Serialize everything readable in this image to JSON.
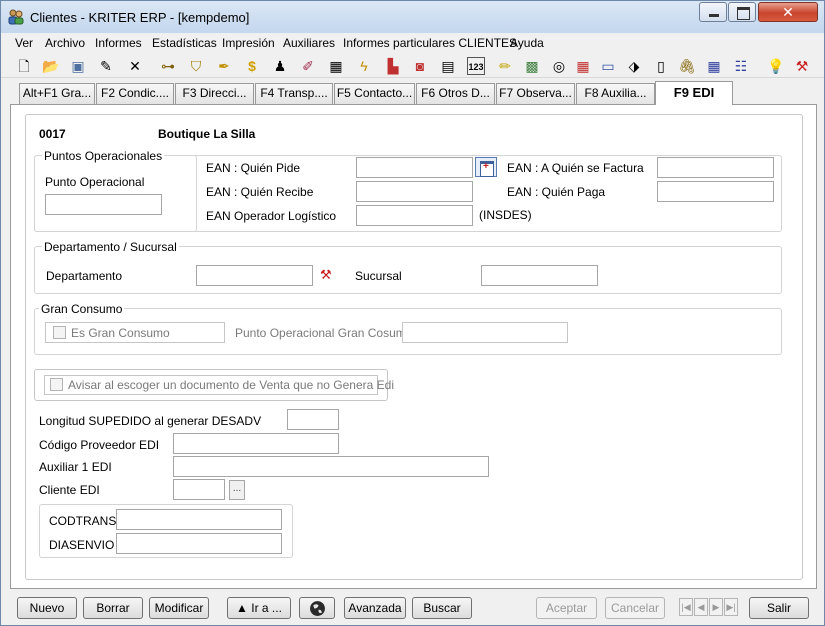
{
  "window": {
    "title": "Clientes - KRITER ERP - [kempdemo]",
    "close_glyph": "✕"
  },
  "menu": [
    "Ver",
    "Archivo",
    "Informes",
    "Estadísticas",
    "Impresión",
    "Auxiliares",
    "Informes particulares CLIENTES",
    "Ayuda"
  ],
  "toolbar_icons": [
    "new-document-icon",
    "open-folder-icon",
    "save-icon",
    "edit-icon",
    "delete-icon",
    "tree-icon",
    "filter-icon",
    "pen-icon",
    "money-icon",
    "stamp-icon",
    "paint-icon",
    "grid-icon",
    "lightning-icon",
    "bar-chart-icon",
    "camera-icon",
    "form-icon",
    "number-icon",
    "pencil-icon",
    "image-icon",
    "cd-icon",
    "calculator-icon",
    "calendar-icon",
    "box-icon",
    "notes-icon",
    "attachment-icon",
    "table-icon",
    "list-icon",
    "lightbulb-icon",
    "tools-icon"
  ],
  "tabs": [
    "Alt+F1 Gra...",
    "F2 Condic....",
    "F3 Direcci...",
    "F4 Transp....",
    "F5 Contacto...",
    "F6 Otros D...",
    "F7 Observa...",
    "F8 Auxilia...",
    "F9 EDI"
  ],
  "client": {
    "code": "0017",
    "name": "Boutique La Silla"
  },
  "puntos_operacionales": {
    "title": "Puntos Operacionales",
    "punto_label": "Punto Operacional",
    "punto_value": "",
    "ean_pide_label": "EAN : Quién Pide",
    "ean_pide_value": "",
    "ean_factura_label": "EAN : A Quién se Factura",
    "ean_factura_value": "",
    "ean_recibe_label": "EAN : Quién Recibe",
    "ean_recibe_value": "",
    "ean_paga_label": "EAN : Quién Paga",
    "ean_paga_value": "",
    "ean_logistico_label": "EAN Operador Logístico",
    "ean_logistico_value": "",
    "insdes_label": "(INSDES)"
  },
  "departamento": {
    "title": "Departamento / Sucursal",
    "dep_label": "Departamento",
    "dep_value": "",
    "suc_label": "Sucursal",
    "suc_value": ""
  },
  "gran_consumo": {
    "title": "Gran Consumo",
    "check_label": "Es Gran Consumo",
    "checked": false,
    "punto_label": "Punto Operacional Gran Cosumo",
    "punto_value": ""
  },
  "avisar": {
    "label": "Avisar al escoger un documento de Venta que no Genera Edi",
    "checked": false
  },
  "longitud": {
    "label": "Longitud SUPEDIDO al generar DESADV",
    "value": ""
  },
  "codigo_proveedor": {
    "label": "Código Proveedor EDI",
    "value": ""
  },
  "auxiliar": {
    "label": "Auxiliar 1 EDI",
    "value": ""
  },
  "cliente_edi": {
    "label": "Cliente EDI",
    "value": "",
    "button": "..."
  },
  "codtrans": {
    "label": "CODTRANS",
    "value": ""
  },
  "diasenvio": {
    "label": "DIASENVIO",
    "value": ""
  },
  "buttons": {
    "nuevo": "Nuevo",
    "borrar": "Borrar",
    "modificar": "Modificar",
    "ira": "▲ Ir a ...",
    "avanzada": "Avanzada",
    "buscar": "Buscar",
    "aceptar": "Aceptar",
    "cancelar": "Cancelar",
    "salir": "Salir"
  },
  "nav_glyphs": [
    "|◀",
    "◀",
    "▶",
    "▶|"
  ]
}
